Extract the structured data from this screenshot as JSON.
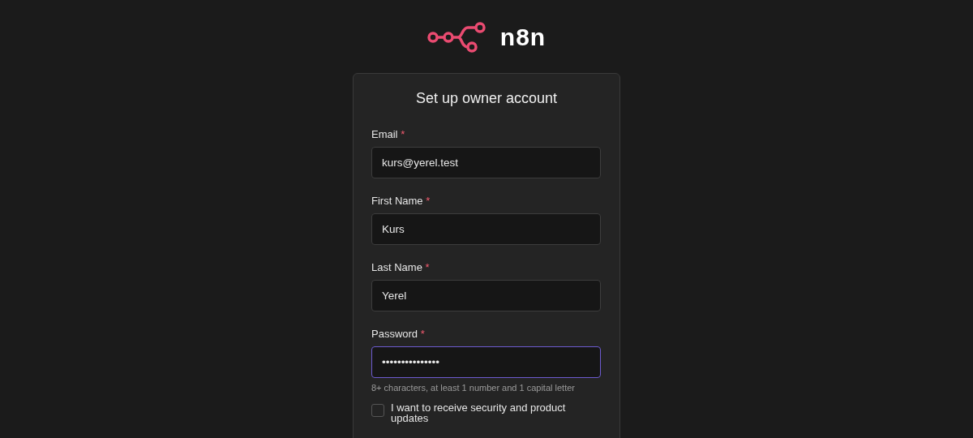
{
  "logo": {
    "wordmark": "n8n"
  },
  "card": {
    "title": "Set up owner account",
    "fields": [
      {
        "label": "Email",
        "required": true,
        "required_mark": "*",
        "value": "kurs@yerel.test",
        "focused": false
      },
      {
        "label": "First Name",
        "required": true,
        "required_mark": "*",
        "value": "Kurs",
        "focused": false
      },
      {
        "label": "Last Name",
        "required": true,
        "required_mark": "*",
        "value": "Yerel",
        "focused": false
      },
      {
        "label": "Password",
        "required": true,
        "required_mark": "*",
        "value": "•••••••••••••••",
        "focused": true,
        "hint": "8+ characters, at least 1 number and 1 capital letter"
      }
    ],
    "checkbox": {
      "label": "I want to receive security and product updates",
      "checked": false
    }
  }
}
